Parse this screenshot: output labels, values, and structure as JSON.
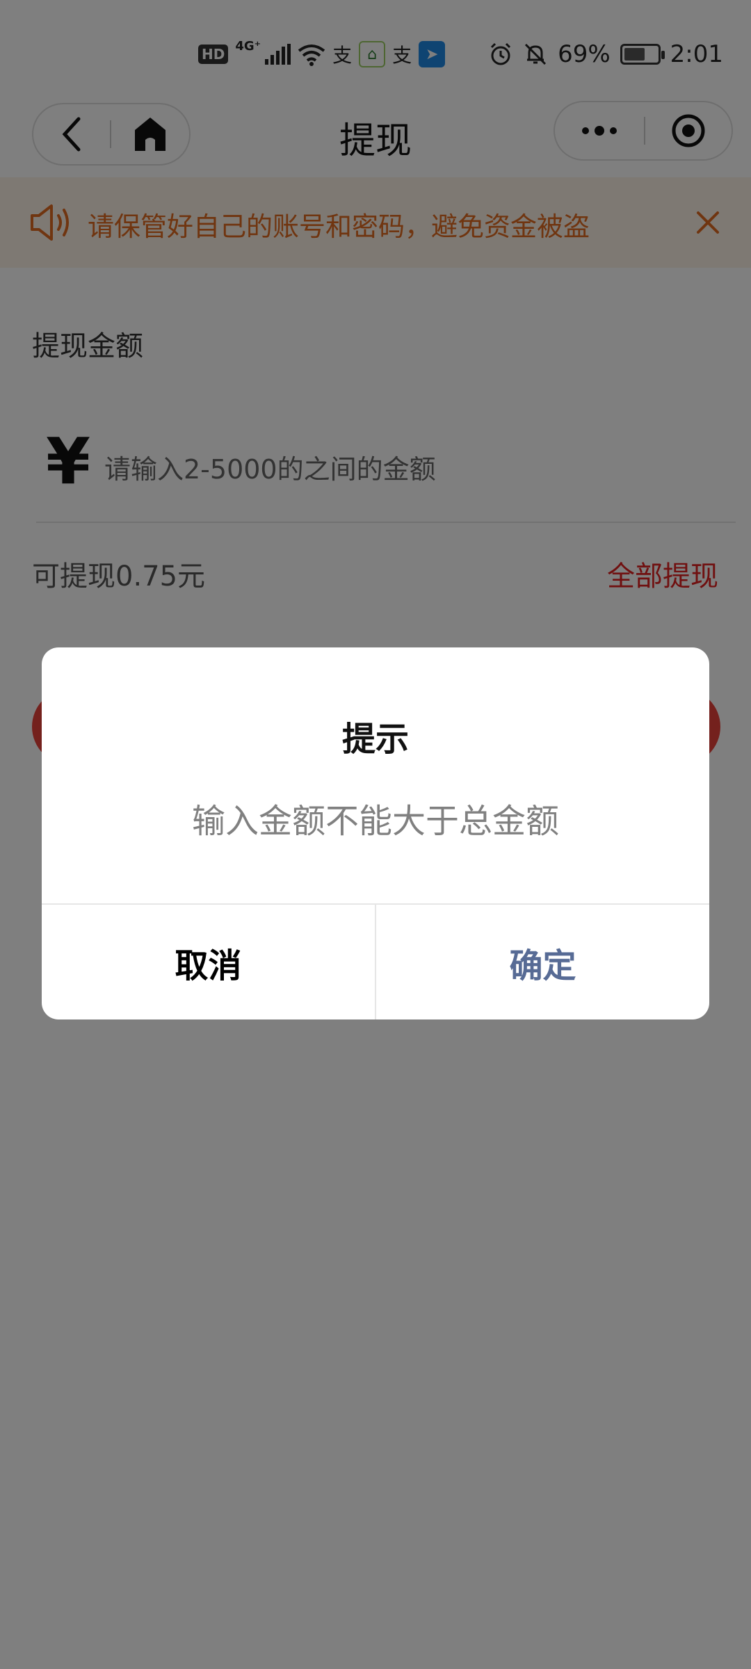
{
  "status_bar": {
    "hd": "HD",
    "network": "4G⁺",
    "battery_percent": "69%",
    "battery_level": 0.69,
    "time": "2:01",
    "icons": [
      "hd-icon",
      "signal-icon",
      "wifi-icon",
      "alipay-icon",
      "green-app-icon",
      "alipay-icon",
      "dingtalk-icon",
      "alarm-icon",
      "mute-icon",
      "battery-icon"
    ]
  },
  "nav": {
    "title": "提现"
  },
  "notice": {
    "text": "请保管好自己的账号和密码，避免资金被盗",
    "color": "#e06a20"
  },
  "withdraw": {
    "amount_label": "提现金额",
    "currency_symbol": "¥",
    "input_placeholder": "请输入2-5000的之间的金额",
    "input_value": "",
    "available_text": "可提现0.75元",
    "withdraw_all_label": "全部提现",
    "accent_color": "#e02020"
  },
  "dialog": {
    "title": "提示",
    "message": "输入金额不能大于总金额",
    "cancel_label": "取消",
    "confirm_label": "确定",
    "confirm_color": "#576b95"
  }
}
